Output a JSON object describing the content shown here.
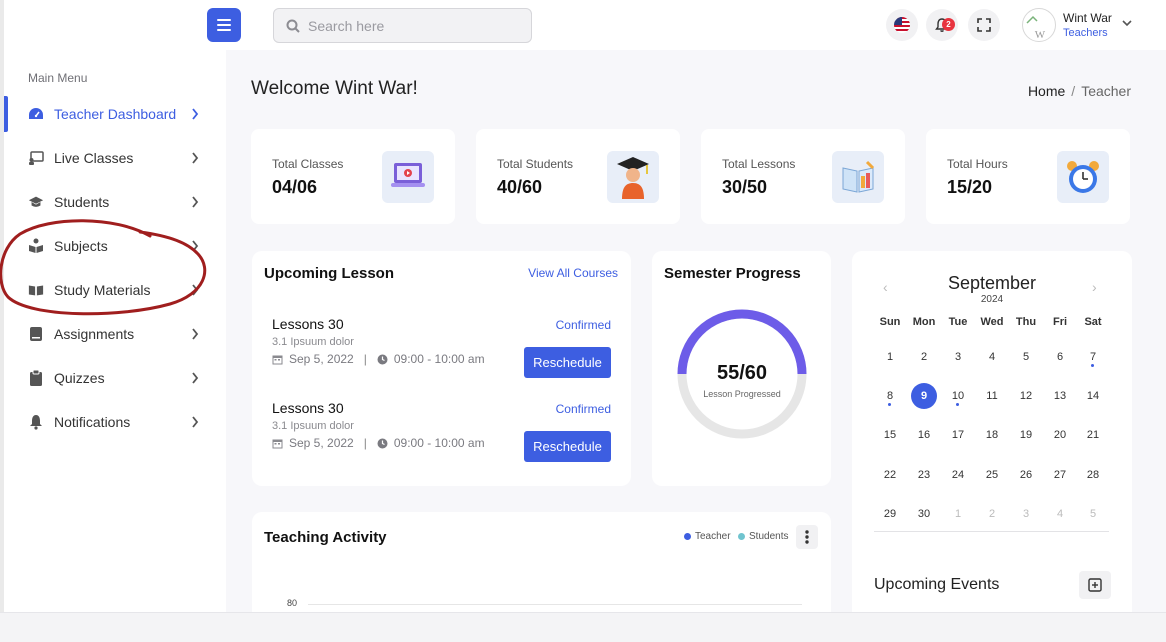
{
  "header": {
    "search_placeholder": "Search here",
    "notification_count": "2",
    "user": {
      "name": "Wint War",
      "role": "Teachers"
    }
  },
  "sidebar": {
    "title": "Main Menu",
    "items": [
      {
        "label": "Teacher Dashboard",
        "icon": "dashboard-icon",
        "active": true
      },
      {
        "label": "Live Classes",
        "icon": "live-class-icon"
      },
      {
        "label": "Students",
        "icon": "graduation-cap-icon"
      },
      {
        "label": "Subjects",
        "icon": "book-reader-icon"
      },
      {
        "label": "Study Materials",
        "icon": "book-open-icon"
      },
      {
        "label": "Assignments",
        "icon": "book-icon"
      },
      {
        "label": "Quizzes",
        "icon": "clipboard-icon"
      },
      {
        "label": "Notifications",
        "icon": "bell-icon"
      }
    ]
  },
  "page": {
    "welcome": "Welcome Wint War!",
    "breadcrumb": {
      "home": "Home",
      "separator": "/",
      "current": "Teacher"
    }
  },
  "stats": [
    {
      "label": "Total Classes",
      "value": "04/06",
      "icon": "laptop-icon"
    },
    {
      "label": "Total Students",
      "value": "40/60",
      "icon": "graduate-icon"
    },
    {
      "label": "Total Lessons",
      "value": "30/50",
      "icon": "book-pencil-icon"
    },
    {
      "label": "Total Hours",
      "value": "15/20",
      "icon": "alarm-clock-icon"
    }
  ],
  "upcoming_lesson": {
    "title": "Upcoming Lesson",
    "link": "View All Courses",
    "lessons": [
      {
        "title": "Lessons 30",
        "subtitle": "3.1 Ipsuum dolor",
        "date": "Sep 5, 2022",
        "time": "09:00 - 10:00 am",
        "status": "Confirmed",
        "button": "Reschedule"
      },
      {
        "title": "Lessons 30",
        "subtitle": "3.1 Ipsuum dolor",
        "date": "Sep 5, 2022",
        "time": "09:00 - 10:00 am",
        "status": "Confirmed",
        "button": "Reschedule"
      }
    ]
  },
  "semester_progress": {
    "title": "Semester Progress",
    "value": "55/60",
    "caption": "Lesson Progressed",
    "fraction": 0.5
  },
  "calendar": {
    "month": "September",
    "year": "2024",
    "prev": "‹",
    "next": "›",
    "days_of_week": [
      "Sun",
      "Mon",
      "Tue",
      "Wed",
      "Thu",
      "Fri",
      "Sat"
    ],
    "weeks": [
      [
        "1",
        "2",
        "3",
        "4",
        "5",
        "6",
        "7"
      ],
      [
        "8",
        "9",
        "10",
        "11",
        "12",
        "13",
        "14"
      ],
      [
        "15",
        "16",
        "17",
        "18",
        "19",
        "20",
        "21"
      ],
      [
        "22",
        "23",
        "24",
        "25",
        "26",
        "27",
        "28"
      ],
      [
        "29",
        "30",
        "1",
        "2",
        "3",
        "4",
        "5"
      ]
    ],
    "selected": "9",
    "event_days": [
      "7",
      "8",
      "10"
    ]
  },
  "upcoming_events": {
    "title": "Upcoming Events"
  },
  "teaching_activity": {
    "title": "Teaching Activity",
    "legend": [
      {
        "name": "Teacher",
        "color": "#3d5ee1"
      },
      {
        "name": "Students",
        "color": "#70c4cf"
      }
    ],
    "y_tick": "80"
  },
  "colors": {
    "primary": "#3d5ee1",
    "progress_track": "#e6e6e6",
    "progress_fill": "#6d5ce8",
    "annotation": "#a01e1e"
  }
}
